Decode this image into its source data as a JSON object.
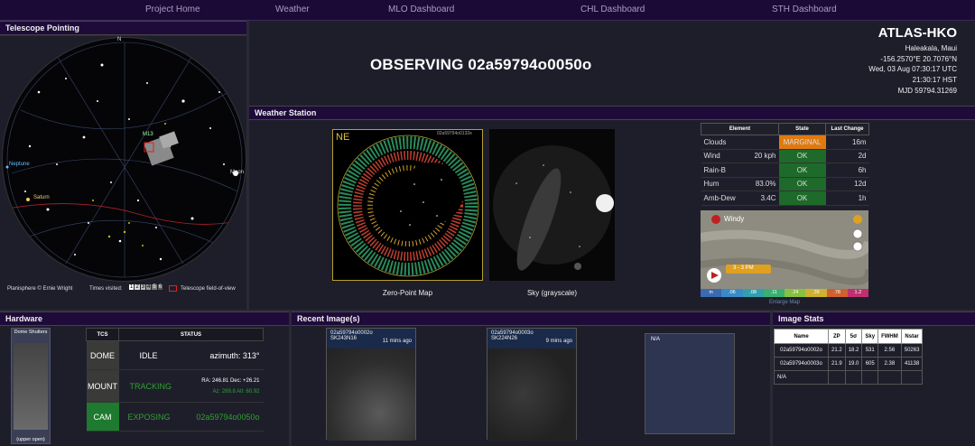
{
  "nav": [
    "Project Home",
    "Weather",
    "MLO Dashboard",
    "CHL Dashboard",
    "STH Dashboard"
  ],
  "telescope_pointing": {
    "title": "Telescope Pointing",
    "labels": [
      "N",
      "Neptune",
      "Saturn",
      "Moon",
      "M13"
    ],
    "footer_credit": "Planisphere © Ernie Wright",
    "footer_times": "Times visited:",
    "footer_times_values": [
      "1",
      "2",
      "3",
      "4",
      "5",
      "6"
    ],
    "footer_fov": "Telescope field-of-view"
  },
  "observing": {
    "title": "OBSERVING 02a59794o0050o",
    "site": "ATLAS-HKO",
    "location": "Haleakala, Maui",
    "coords": "-156.2570°E 20.7076°N",
    "utc": "Wed, 03 Aug 07:30:17 UTC",
    "hst": "21:30:17 HST",
    "mjd": "MJD 59794.31269"
  },
  "weather": {
    "title": "Weather Station",
    "zp_caption": "Zero-Point Map",
    "zp_direction": "NE",
    "zp_header": "02a59794o0132e",
    "sky_caption": "Sky (grayscale)",
    "table_headers": [
      "Element",
      "State",
      "Last Change"
    ],
    "rows": [
      {
        "element": "Clouds",
        "value": "",
        "state": "MARGINAL",
        "change": "16m"
      },
      {
        "element": "Wind",
        "value": "20 kph",
        "state": "OK",
        "change": "2d"
      },
      {
        "element": "Rain-B",
        "value": "",
        "state": "OK",
        "change": "6h"
      },
      {
        "element": "Hum",
        "value": "83.0%",
        "state": "OK",
        "change": "12d"
      },
      {
        "element": "Amb-Dew",
        "value": "3.4C",
        "state": "OK",
        "change": "1h"
      }
    ],
    "windy_label": "Windy",
    "windy_time": "3 - 3 PM",
    "windy_scale": [
      "in",
      ".06",
      ".08",
      ".11",
      ".24",
      ".39",
      ".78",
      "1.2"
    ],
    "windy_scale_colors": [
      "#3a6ab0",
      "#3a8ac8",
      "#30a0b0",
      "#38b070",
      "#88c040",
      "#d0b030",
      "#d06030",
      "#c03070"
    ],
    "enlarge": "Enlarge Map"
  },
  "hardware": {
    "title": "Hardware",
    "dome_top": "Dome Shutters",
    "dome_bottom": "(upper open)",
    "headers": [
      "TCS",
      "STATUS"
    ],
    "dome_label": "DOME",
    "dome_state": "IDLE",
    "dome_detail": "azimuth: 313°",
    "mount_label": "MOUNT",
    "mount_state": "TRACKING",
    "mount_detail1": "RA: 246.81 Dec: +26.21",
    "mount_detail2": "Az: 289.8 Alt: 60.92",
    "cam_label": "CAM",
    "cam_state": "EXPOSING",
    "cam_detail": "02a59794o0050o"
  },
  "recent": {
    "title": "Recent Image(s)",
    "images": [
      {
        "id": "02a59794o0002o",
        "field": "SK243N16",
        "age": "11 mins ago"
      },
      {
        "id": "02a59794o0003o",
        "field": "SK224N26",
        "age": "9 mins ago"
      },
      {
        "id": "N/A",
        "field": "",
        "age": ""
      }
    ]
  },
  "image_stats": {
    "title": "Image Stats",
    "headers": [
      "Name",
      "ZP",
      "5σ",
      "Sky",
      "FWHM",
      "Nstar"
    ],
    "rows": [
      [
        "02a59794o0002o",
        "21.2",
        "18.2",
        "531",
        "2.56",
        "50263"
      ],
      [
        "02a59794o0003o",
        "21.9",
        "19.0",
        "605",
        "2.38",
        "41138"
      ],
      [
        "N/A",
        "",
        "",
        "",
        "",
        ""
      ]
    ]
  }
}
